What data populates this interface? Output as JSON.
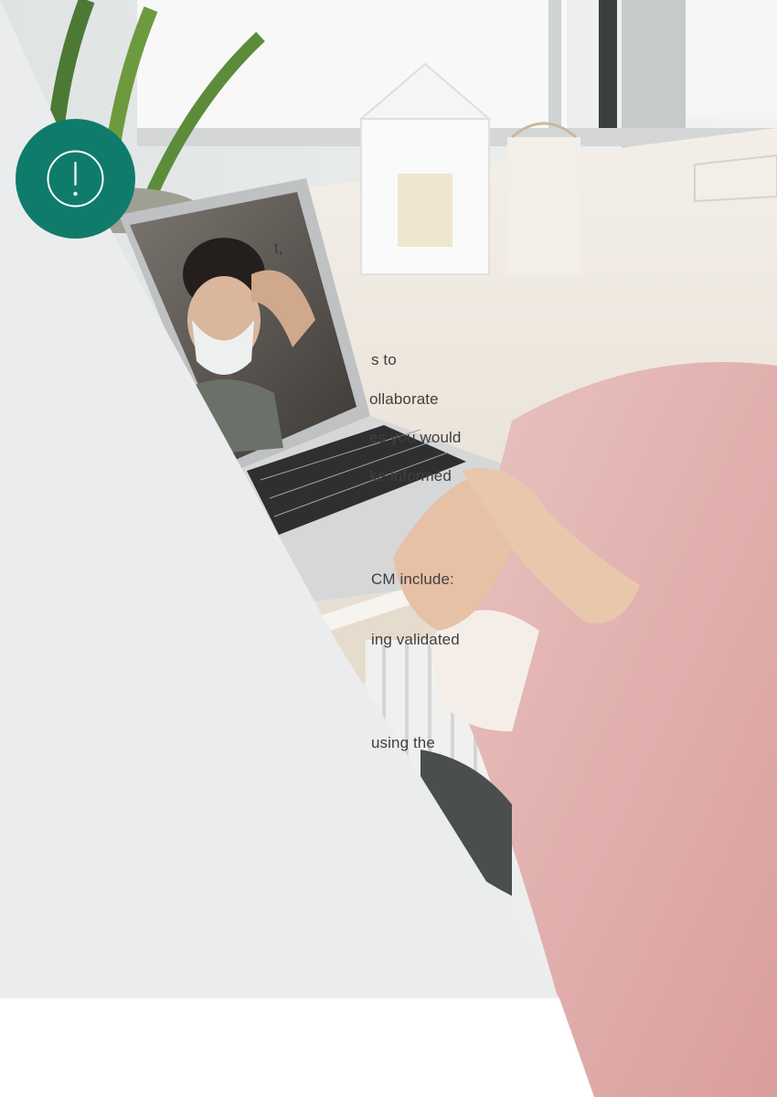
{
  "text_lines": [
    "t,",
    "s to",
    "ollaborate",
    "es you would",
    "ke informed",
    "CM include:",
    "ing validated",
    "using the"
  ],
  "icons": {
    "alert": "exclamation-circle-icon"
  },
  "colors": {
    "panel": "#ebeced",
    "badge": "#0f7c6b",
    "text": "#3f3f3f",
    "footer": "#ffffff"
  }
}
